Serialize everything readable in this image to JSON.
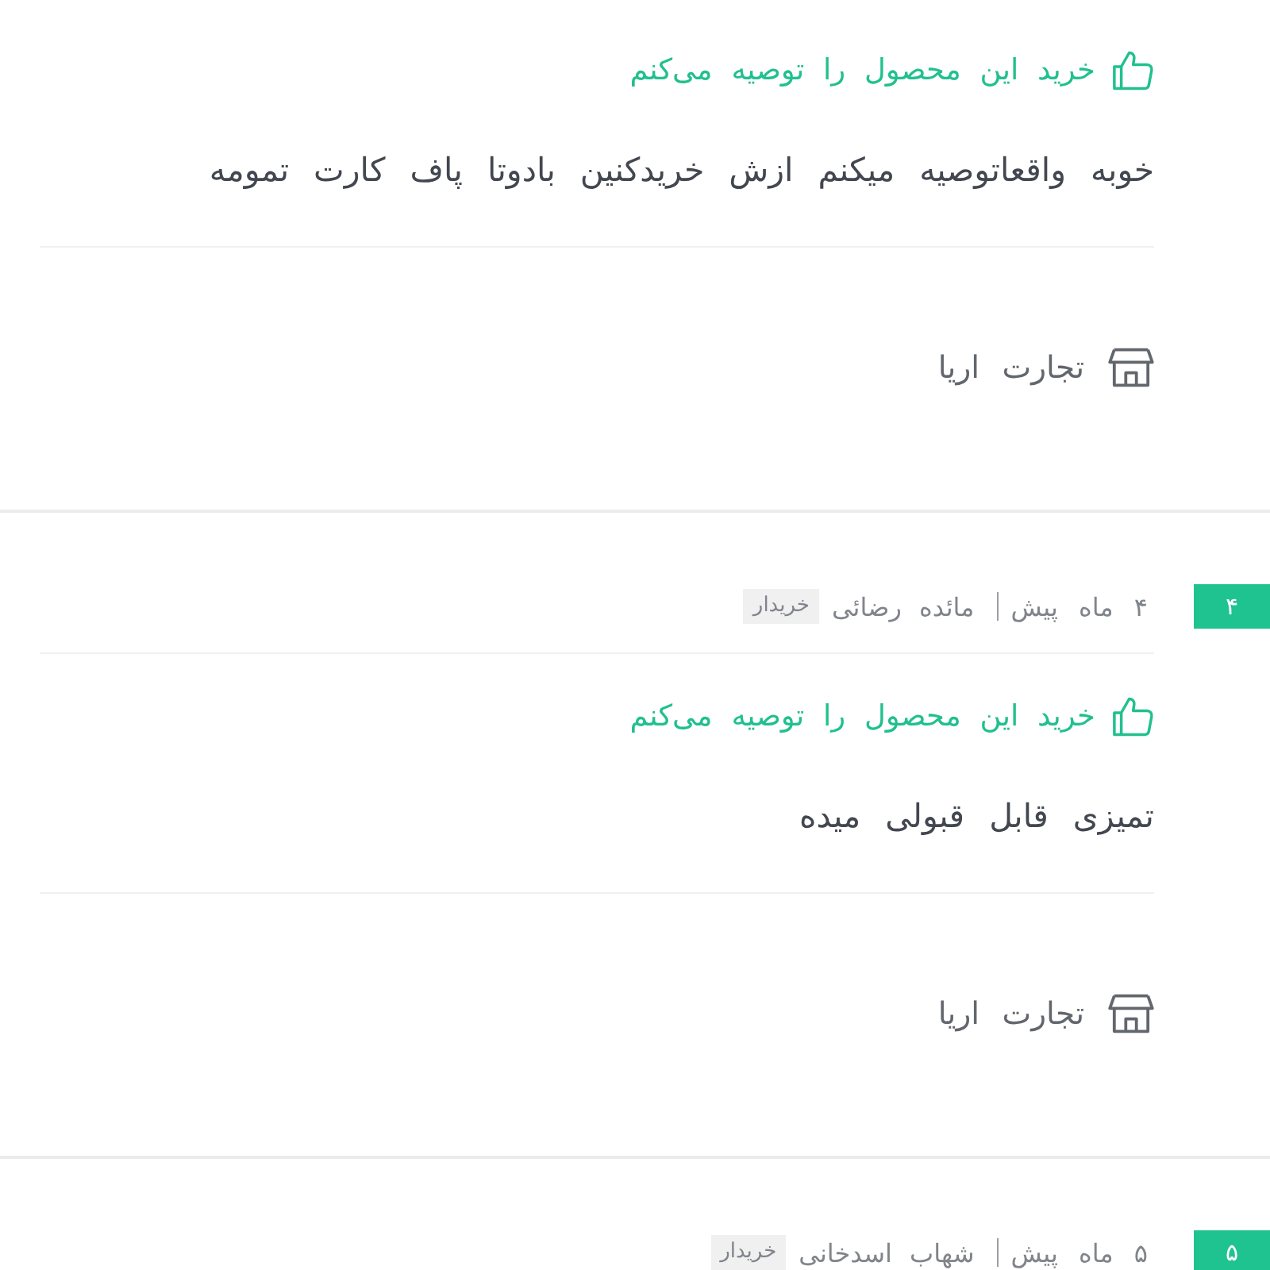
{
  "reviews": [
    {
      "recommendation": "خرید این محصول را توصیه می‌کنم",
      "comment": "خوبه واقعاتوصیه میکنم ازش خریدکنین بادوتا پاف کارت تمومه",
      "seller": "تجارت اریا"
    },
    {
      "rank": "۴",
      "date": "۴ ماه پیش",
      "author": "مائده رضائی",
      "author_badge": "خریدار",
      "recommendation": "خرید این محصول را توصیه می‌کنم",
      "comment": "تمیزی قابل قبولی میده",
      "seller": "تجارت اریا"
    },
    {
      "rank": "۵",
      "date": "۵ ماه پیش",
      "author": "شهاب اسدخانی",
      "author_badge": "خریدار"
    }
  ]
}
